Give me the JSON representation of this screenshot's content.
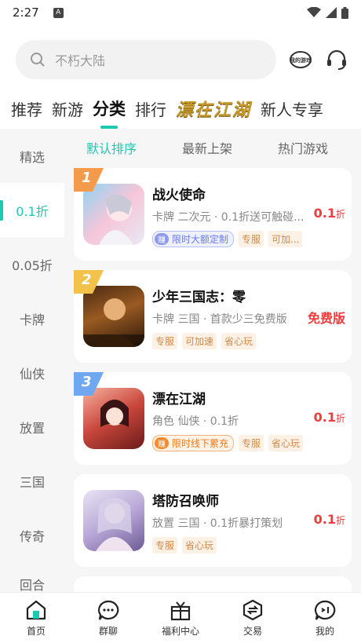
{
  "status": {
    "time": "2:27",
    "a_badge": "A"
  },
  "search": {
    "placeholder": "不朽大陆"
  },
  "header_icons": {
    "my_games_label": "我的游戏",
    "service": "customer-service-icon"
  },
  "top_tabs": [
    {
      "label": "推荐"
    },
    {
      "label": "新游"
    },
    {
      "label": "分类",
      "active": true
    },
    {
      "label": "排行"
    },
    {
      "label": "漂在江湖",
      "brand": true
    },
    {
      "label": "新人专享"
    }
  ],
  "sidebar": {
    "items": [
      {
        "label": "精选"
      },
      {
        "label": "0.1折",
        "active": true
      },
      {
        "label": "0.05折"
      },
      {
        "label": "卡牌"
      },
      {
        "label": "仙侠"
      },
      {
        "label": "放置"
      },
      {
        "label": "三国"
      },
      {
        "label": "传奇"
      },
      {
        "label": "回合"
      }
    ]
  },
  "sub_tabs": [
    {
      "label": "默认排序",
      "active": true
    },
    {
      "label": "最新上架"
    },
    {
      "label": "热门游戏"
    }
  ],
  "games": [
    {
      "rank": "1",
      "name": "战火使命",
      "desc": "卡牌 二次元 · 0.1折送可触碰...",
      "promo_badge": "赚",
      "promo_text": "限时大额定制",
      "tags": [
        "专服",
        "可加..."
      ],
      "price": "0.1",
      "price_unit": "折"
    },
    {
      "rank": "2",
      "name": "少年三国志：零",
      "desc": "卡牌 三国 · 首款少三免费版",
      "tags": [
        "专服",
        "可加速",
        "省心玩"
      ],
      "price": "免费版",
      "price_unit": ""
    },
    {
      "rank": "3",
      "name": "漂在江湖",
      "desc": "角色 仙侠 · 0.1折",
      "promo_badge": "赚",
      "promo_text": "限时线下累充",
      "tags": [
        "专服",
        "省心玩"
      ],
      "price": "0.1",
      "price_unit": "折"
    },
    {
      "name": "塔防召唤师",
      "desc": "放置 三国 · 0.1折暴打策划",
      "tags": [
        "专服",
        "省心玩"
      ],
      "price": "0.1",
      "price_unit": "折"
    }
  ],
  "bottom_nav": [
    {
      "label": "首页"
    },
    {
      "label": "群聊"
    },
    {
      "label": "福利中心"
    },
    {
      "label": "交易"
    },
    {
      "label": "我的"
    }
  ],
  "colors": {
    "accent": "#1dc9b0",
    "price": "#f03c3c",
    "rank1": "#f39b4b",
    "rank2": "#f2c24a",
    "rank3": "#6fa8f0"
  }
}
